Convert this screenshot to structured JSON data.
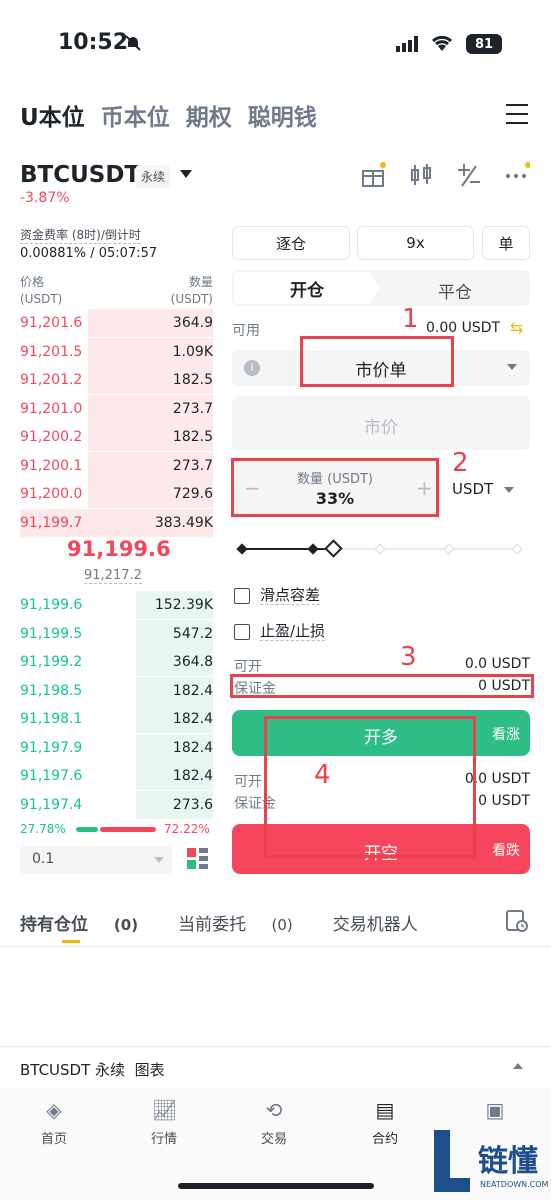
{
  "status_bar": {
    "time": "10:52",
    "battery": "81"
  },
  "top_tabs": [
    "U本位",
    "币本位",
    "期权",
    "聪明钱"
  ],
  "header": {
    "symbol": "BTCUSDT",
    "perp_tag": "永续",
    "change": "-3.87%"
  },
  "funding": {
    "label": "资金费率 (8时)/倒计时",
    "value": "0.00881% / 05:07:57"
  },
  "orderbook": {
    "price_label": "价格",
    "price_unit": "(USDT)",
    "qty_label": "数量",
    "qty_unit": "(USDT)",
    "asks": [
      {
        "p": "91,201.6",
        "q": "364.9",
        "depth": 0.65
      },
      {
        "p": "91,201.5",
        "q": "1.09K",
        "depth": 0.65
      },
      {
        "p": "91,201.2",
        "q": "182.5",
        "depth": 0.65
      },
      {
        "p": "91,201.0",
        "q": "273.7",
        "depth": 0.65
      },
      {
        "p": "91,200.2",
        "q": "182.5",
        "depth": 0.65
      },
      {
        "p": "91,200.1",
        "q": "273.7",
        "depth": 0.65
      },
      {
        "p": "91,200.0",
        "q": "729.6",
        "depth": 0.65
      },
      {
        "p": "91,199.7",
        "q": "383.49K",
        "depth": 1.0
      }
    ],
    "mid_price": "91,199.6",
    "mark_price": "91,217.2",
    "bids": [
      {
        "p": "91,199.6",
        "q": "152.39K",
        "depth": 0.4
      },
      {
        "p": "91,199.5",
        "q": "547.2",
        "depth": 0.4
      },
      {
        "p": "91,199.2",
        "q": "364.8",
        "depth": 0.4
      },
      {
        "p": "91,198.5",
        "q": "182.4",
        "depth": 0.4
      },
      {
        "p": "91,198.1",
        "q": "182.4",
        "depth": 0.4
      },
      {
        "p": "91,197.9",
        "q": "182.4",
        "depth": 0.4
      },
      {
        "p": "91,197.6",
        "q": "182.4",
        "depth": 0.4
      },
      {
        "p": "91,197.4",
        "q": "273.6",
        "depth": 0.4
      }
    ],
    "buy_ratio": "27.78%",
    "sell_ratio": "72.22%",
    "precision": "0.1"
  },
  "order_panel": {
    "margin_mode": "逐仓",
    "leverage": "9x",
    "position_mode": "单",
    "open_tab": "开仓",
    "close_tab": "平仓",
    "available_label": "可用",
    "available_value": "0.00 USDT",
    "order_type": "市价单",
    "price_placeholder": "市价",
    "qty_label": "数量 (USDT)",
    "qty_value": "33%",
    "qty_unit": "USDT",
    "minus": "−",
    "plus": "+",
    "slider_fraction": 0.33,
    "slippage_label": "滑点容差",
    "tpsl_label": "止盈/止损",
    "long_max_label": "可开",
    "long_max_value": "0.0 USDT",
    "long_margin_label": "保证金",
    "long_margin_value": "0 USDT",
    "long_button": "开多",
    "long_hint": "看涨",
    "short_max_label": "可开",
    "short_max_value": "0.0 USDT",
    "short_margin_label": "保证金",
    "short_margin_value": "0 USDT",
    "short_button": "开空",
    "short_hint": "看跌"
  },
  "annotations": [
    "1",
    "2",
    "3",
    "4"
  ],
  "position_tabs": {
    "holdings": "持有仓位",
    "holdings_count": "(0)",
    "open_orders": "当前委托",
    "open_orders_count": "(0)",
    "bots": "交易机器人"
  },
  "chart_bar": {
    "label": "BTCUSDT 永续  图表"
  },
  "bottom_nav": [
    "首页",
    "行情",
    "交易",
    "合约",
    ""
  ],
  "watermark": {
    "brand": "链懂",
    "domain": "NEATDOWN.COM"
  },
  "colors": {
    "green": "#2ebd85",
    "red": "#f6465d",
    "accent": "#f0b90b",
    "annotation": "#e8434c"
  }
}
